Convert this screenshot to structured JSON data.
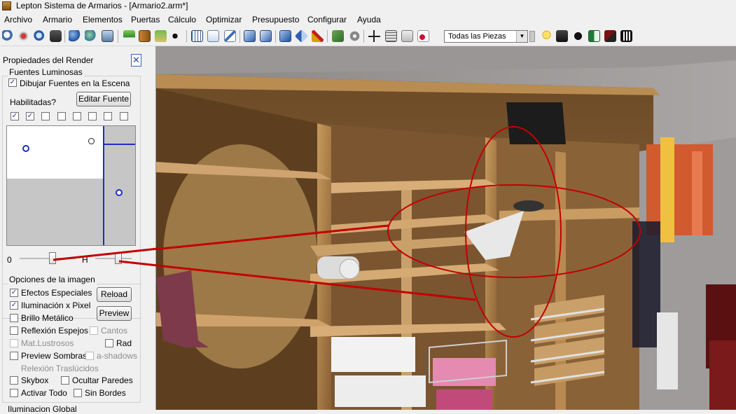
{
  "window": {
    "title": "Lepton Sistema de Armarios - [Armario2.arm*]"
  },
  "menu": [
    "Archivo",
    "Armario",
    "Elementos",
    "Puertas",
    "Cálculo",
    "Optimizar",
    "Presupuesto",
    "Configurar",
    "Ayuda"
  ],
  "toolbar": {
    "icons": [
      "zoom-icon",
      "add-icon",
      "zoom-fit-icon",
      "camera-icon",
      "sphere-icon",
      "globe-icon",
      "photo-icon",
      "funnel-icon",
      "door-icon",
      "filter-icon",
      "point-icon",
      "grid-icon",
      "search-doc-icon",
      "edit-icon",
      "cube-icon",
      "cube-front-icon",
      "box-icon",
      "box-open-icon",
      "wand-icon",
      "check-icon",
      "gear-icon",
      "crosshair-icon",
      "table-icon",
      "music-icon",
      "bulb-icon",
      "camera-icon",
      "twitter-icon",
      "excel-icon",
      "layers-icon",
      "film-icon"
    ],
    "piece_filter": "Todas las Piezas"
  },
  "render_panel": {
    "title": "Propiedades del Render",
    "lights_group": "Fuentes Luminosas",
    "draw_lights": {
      "label": "Dibujar Fuentes en la Escena",
      "checked": true
    },
    "edit_source": "Editar Fuente",
    "enabled_label": "Habilitadas?",
    "enabled": [
      true,
      true,
      false,
      false,
      false,
      false,
      false,
      false
    ],
    "slider_left_label": "0",
    "slider_right_label": "H",
    "image_options_group": "Opciones de la imagen",
    "reload": "Reload",
    "preview": "Preview",
    "options": {
      "special_effects": {
        "label": "Efectos Especiales",
        "checked": true
      },
      "pixel_lighting": {
        "label": "Iluminación x Pixel",
        "checked": true
      },
      "metallic": {
        "label": "Brillo Metálico",
        "checked": false
      },
      "mirror_reflection": {
        "label": "Reflexión Espejos",
        "checked": false
      },
      "edges": {
        "label": "Cantos",
        "checked": false,
        "disabled": true
      },
      "glossy": {
        "label": "Mat.Lustrosos",
        "checked": false,
        "disabled": true
      },
      "rad": {
        "label": "Rad",
        "checked": false
      },
      "preview_shadows": {
        "label": "Preview Sombras",
        "checked": false
      },
      "a_shadows": {
        "label": "a-shadows",
        "checked": false,
        "disabled": true
      },
      "translucent": {
        "label": "Relexión Traslúcidos",
        "disabled": true
      },
      "skybox": {
        "label": "Skybox",
        "checked": false
      },
      "hide_walls": {
        "label": "Ocultar Paredes",
        "checked": false
      },
      "activate_all": {
        "label": "Activar Todo",
        "checked": false
      },
      "borderless": {
        "label": "Sin Bordes",
        "checked": false
      }
    },
    "global_illumination": "Iluminacion Global"
  }
}
